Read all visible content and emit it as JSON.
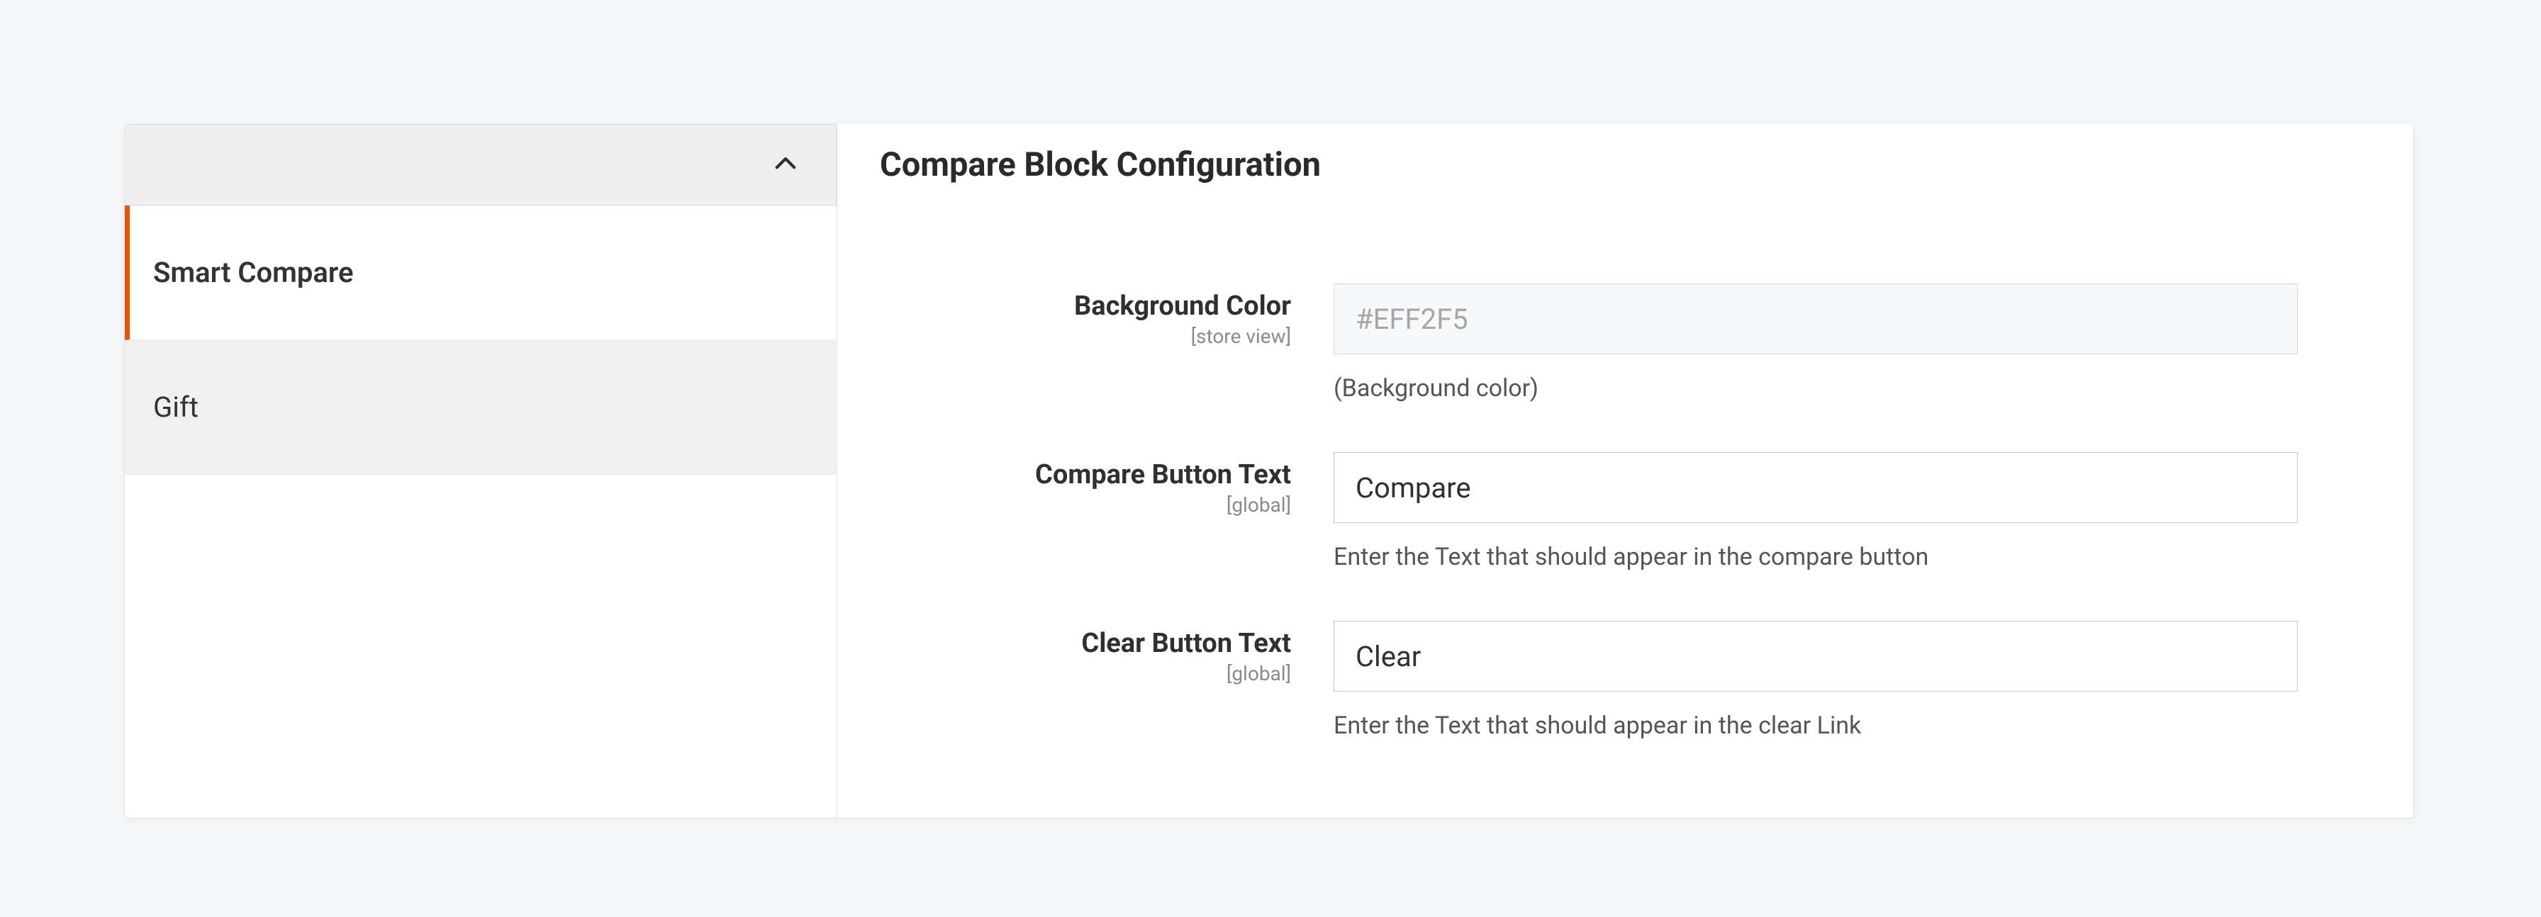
{
  "sidebar": {
    "items": [
      {
        "label": "Smart Compare",
        "active": true
      },
      {
        "label": "Gift",
        "active": false
      }
    ]
  },
  "main": {
    "title": "Compare Block Configuration",
    "fields": {
      "background_color": {
        "label": "Background Color",
        "scope": "[store view]",
        "value": "#EFF2F5",
        "helper": "(Background color)"
      },
      "compare_button_text": {
        "label": "Compare Button Text",
        "scope": "[global]",
        "value": "Compare",
        "helper": "Enter the Text that should appear in the compare button"
      },
      "clear_button_text": {
        "label": "Clear Button Text",
        "scope": "[global]",
        "value": "Clear",
        "helper": "Enter the Text that should appear in the clear Link"
      }
    }
  }
}
